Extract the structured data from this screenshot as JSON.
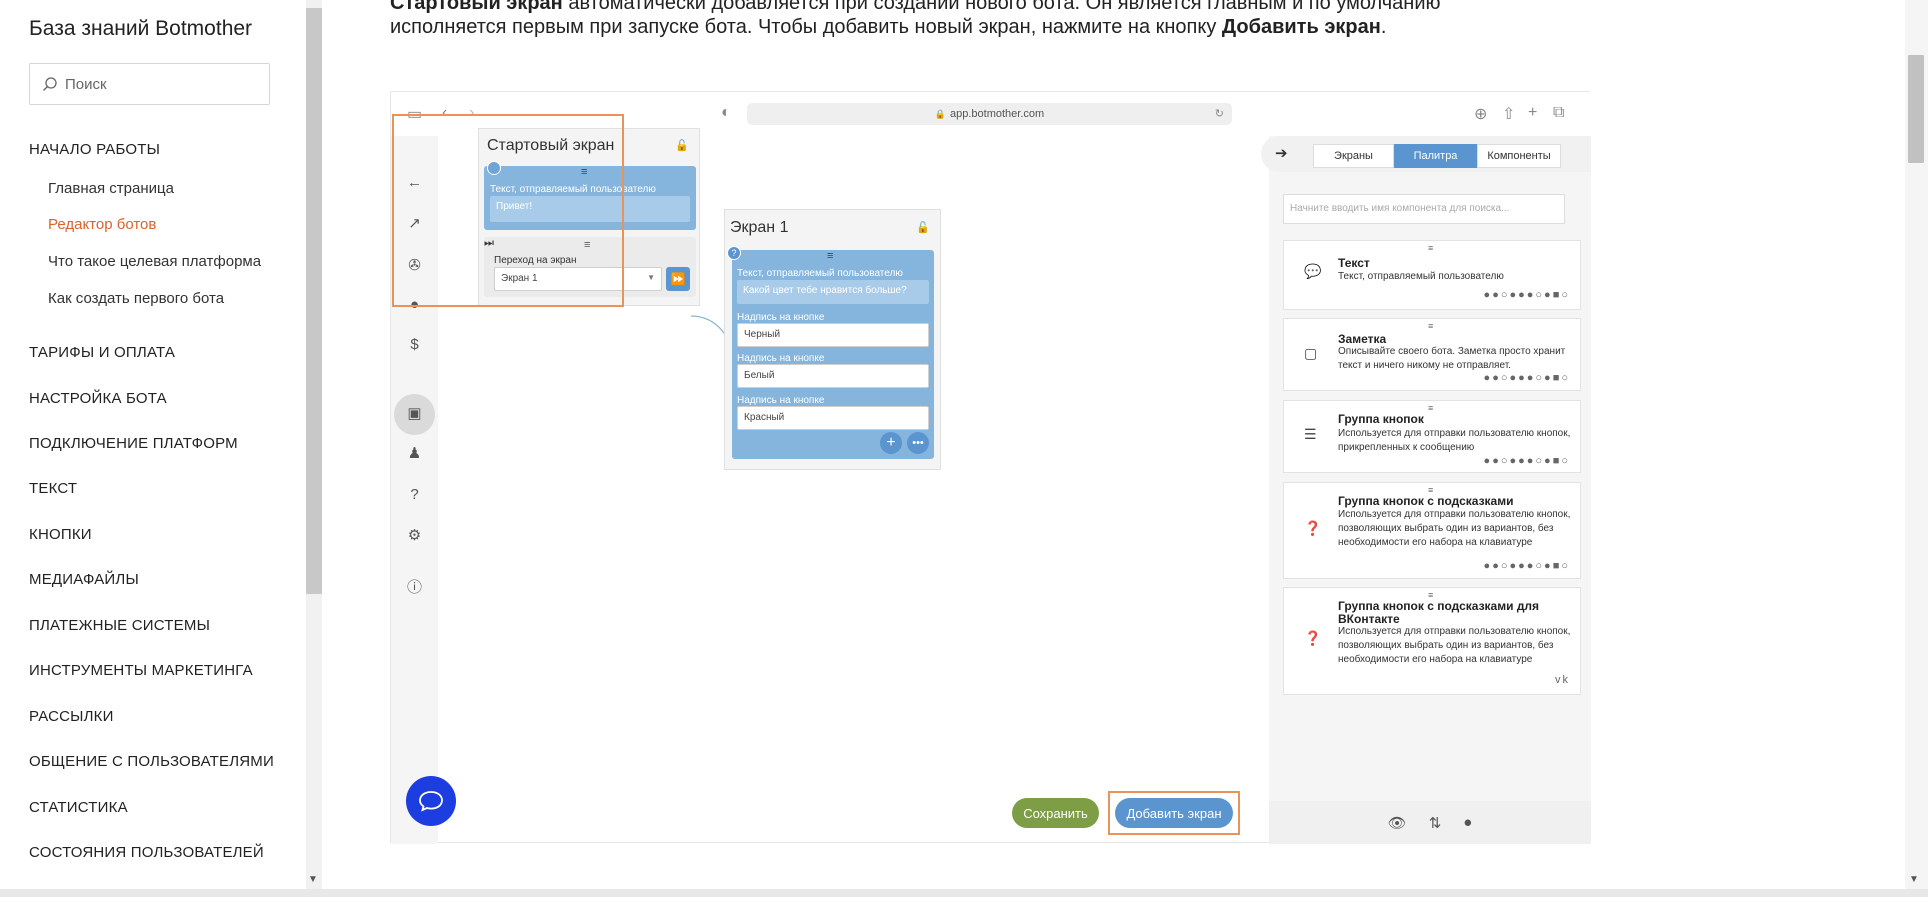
{
  "sidebar": {
    "title": "База знаний Botmother",
    "search_placeholder": "Поиск",
    "sections": [
      {
        "label": "НАЧАЛО РАБОТЫ"
      },
      {
        "label": "ТАРИФЫ И ОПЛАТА"
      },
      {
        "label": "НАСТРОЙКА БОТА"
      },
      {
        "label": "ПОДКЛЮЧЕНИЕ ПЛАТФОРМ"
      },
      {
        "label": "ТЕКСТ"
      },
      {
        "label": "КНОПКИ"
      },
      {
        "label": "МЕДИАФАЙЛЫ"
      },
      {
        "label": "ПЛАТЕЖНЫЕ СИСТЕМЫ"
      },
      {
        "label": "ИНСТРУМЕНТЫ МАРКЕТИНГА"
      },
      {
        "label": "РАССЫЛКИ"
      },
      {
        "label": "ОБЩЕНИЕ С ПОЛЬЗОВАТЕЛЯМИ"
      },
      {
        "label": "СТАТИСТИКА"
      },
      {
        "label": "СОСТОЯНИЯ ПОЛЬЗОВАТЕЛЕЙ"
      }
    ],
    "subitems": [
      {
        "label": "Главная страница"
      },
      {
        "label": "Редактор ботов"
      },
      {
        "label": "Что такое целевая платформа"
      },
      {
        "label": "Как создать первого бота"
      }
    ]
  },
  "intro": {
    "line1_bold": "Стартовый экран",
    "line1_rest": " автоматически добавляется при создании нового бота. Он является главным и по умолчанию",
    "line2_a": "исполняется первым при запуске бота. Чтобы добавить новый экран, нажмите на кнопку ",
    "line2_bold": "Добавить экран",
    "line2_end": "."
  },
  "screenshot": {
    "url": "app.botmother.com",
    "start_screen": {
      "title": "Стартовый экран",
      "text_label": "Текст, отправляемый пользователю",
      "text_value": "Привет!",
      "goto_label": "Переход на экран",
      "goto_value": "Экран 1"
    },
    "screen1": {
      "title": "Экран 1",
      "text_label": "Текст, отправляемый пользователю",
      "text_value": "Какой цвет тебе нравится больше?",
      "buttons": [
        {
          "label": "Надпись на кнопке",
          "value": "Черный"
        },
        {
          "label": "Надпись на кнопке",
          "value": "Белый"
        },
        {
          "label": "Надпись на кнопке",
          "value": "Красный"
        }
      ]
    },
    "save_label": "Сохранить",
    "add_label": "Добавить экран",
    "panel": {
      "tabs": [
        {
          "label": "Экраны"
        },
        {
          "label": "Палитра"
        },
        {
          "label": "Компоненты"
        }
      ],
      "active_tab": "Палитра",
      "search_placeholder": "Начните вводить имя компонента для поиска...",
      "components": [
        {
          "title": "Текст",
          "desc": "Текст, отправляемый пользователю",
          "icon": "speech-bubble-icon"
        },
        {
          "title": "Заметка",
          "desc": "Описывайте своего бота. Заметка просто хранит текст и ничего никому не отправляет.",
          "icon": "note-icon"
        },
        {
          "title": "Группа кнопок",
          "desc": "Используется для отправки пользователю кнопок, прикрепленных к сообщению",
          "icon": "menu-lines-icon"
        },
        {
          "title": "Группа кнопок с подсказками",
          "desc": "Используется для отправки пользователю кнопок, позволяющих выбрать один из вариантов, без необходимости его набора на клавиатуре",
          "icon": "question-icon"
        },
        {
          "title": "Группа кнопок с подсказками для ВКонтакте",
          "desc": "Используется для отправки пользователю кнопок, позволяющих выбрать один из вариантов, без необходимости его набора на клавиатуре",
          "icon": "question-icon"
        }
      ]
    }
  },
  "colors": {
    "accent": "#d9632a",
    "blue": "#5b95cf",
    "green": "#7e9e45",
    "chat": "#1c3de0"
  }
}
